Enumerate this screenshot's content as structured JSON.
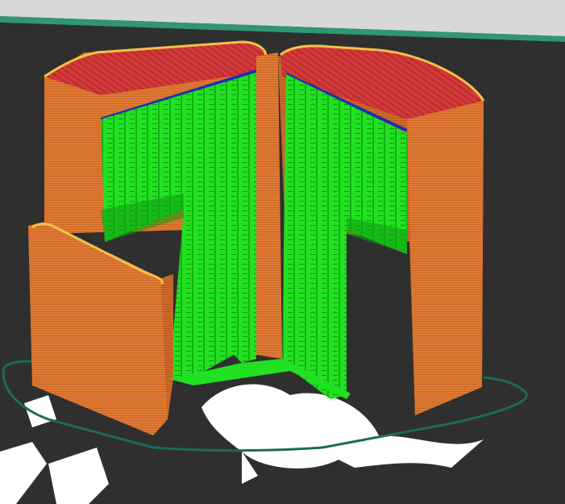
{
  "app": {
    "view": "3d-print-preview"
  },
  "scene": {
    "background_color": "#2f2f2f",
    "bed_top_color": "#d8d8d8",
    "outer_wall_color": "#e07a32",
    "outer_wall_shade_color": "#c9682a",
    "top_solid_infill_color": "#d3393a",
    "perimeter_edge_color": "#f2c04a",
    "support_color": "#22e022",
    "support_dark_color": "#10a010",
    "bridge_color": "#1f2fb0",
    "skirt_color": "#1b6b5a",
    "bed_logo_color": "#ffffff",
    "bed_line_color": "#2fb08a"
  }
}
